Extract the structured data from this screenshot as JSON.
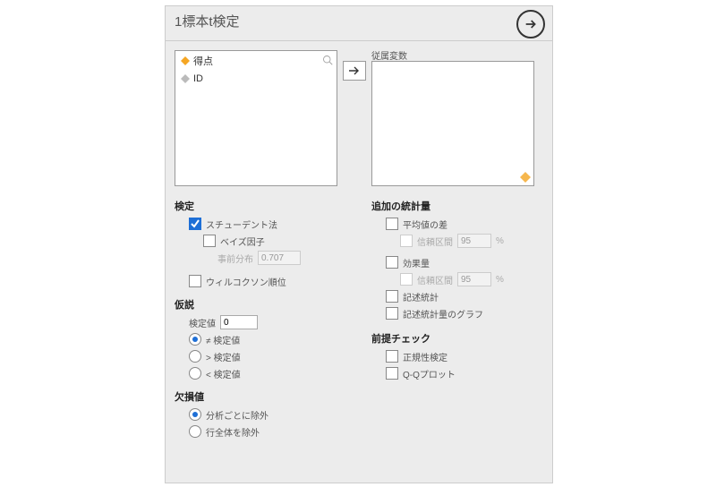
{
  "header": {
    "title": "1標本t検定"
  },
  "vars": {
    "dv_label": "従属変数",
    "items": [
      {
        "label": "得点",
        "icon": "orange"
      },
      {
        "label": "ID",
        "icon": "gray"
      }
    ]
  },
  "tests": {
    "h": "検定",
    "student": "スチューデント法",
    "bayes": "ベイズ因子",
    "prior_label": "事前分布",
    "prior_val": "0.707",
    "wilcoxon": "ウィルコクソン順位"
  },
  "hyp": {
    "h": "仮説",
    "testval_label": "検定値",
    "testval": "0",
    "ne": "≠ 検定値",
    "gt": "> 検定値",
    "lt": "< 検定値"
  },
  "missing": {
    "h": "欠損値",
    "per": "分析ごとに除外",
    "list": "行全体を除外"
  },
  "add": {
    "h": "追加の統計量",
    "meandiff": "平均値の差",
    "ci1_label": "信頼区間",
    "ci1": "95",
    "es": "効果量",
    "ci2_label": "信頼区間",
    "ci2": "95",
    "desc": "記述統計",
    "descplot": "記述統計量のグラフ",
    "pct": "%"
  },
  "assume": {
    "h": "前提チェック",
    "norm": "正規性検定",
    "qq": "Q-Qプロット"
  }
}
